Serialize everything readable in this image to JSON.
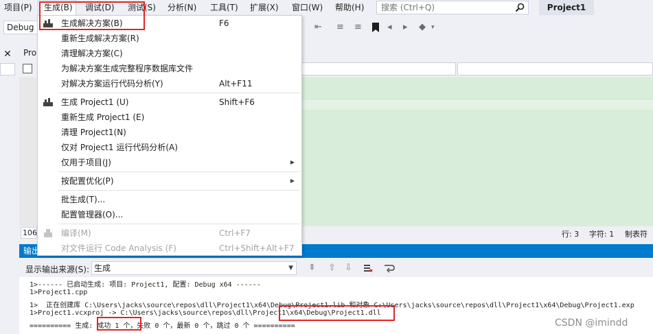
{
  "menubar": {
    "items": [
      "项目(P)",
      "生成(B)",
      "调试(D)",
      "测试(S)",
      "分析(N)",
      "工具(T)",
      "扩展(X)",
      "窗口(W)",
      "帮助(H)"
    ],
    "search_placeholder": "搜索 (Ctrl+Q)",
    "solution_title": "Project1"
  },
  "toolbar": {
    "config": "Debug"
  },
  "editor": {
    "doc_tab": "Pro",
    "nav_left_icon": "class-icon"
  },
  "status": {
    "zoom": "106",
    "line": "行: 3",
    "col": "字符: 1",
    "tabs": "制表符"
  },
  "build_menu": {
    "items": [
      {
        "label": "生成解决方案(B)",
        "shortcut": "F6",
        "icon": "build-solution-icon"
      },
      {
        "label": "重新生成解决方案(R)",
        "shortcut": ""
      },
      {
        "label": "清理解决方案(C)",
        "shortcut": ""
      },
      {
        "label": "为解决方案生成完整程序数据库文件",
        "shortcut": ""
      },
      {
        "label": "对解决方案运行代码分析(Y)",
        "shortcut": "Alt+F11"
      },
      {
        "label": "生成 Project1 (U)",
        "shortcut": "Shift+F6",
        "icon": "build-project-icon"
      },
      {
        "label": "重新生成 Project1 (E)",
        "shortcut": ""
      },
      {
        "label": "清理 Project1(N)",
        "shortcut": ""
      },
      {
        "label": "仅对 Project1 运行代码分析(A)",
        "shortcut": ""
      },
      {
        "label": "仅用于项目(J)",
        "shortcut": "",
        "submenu": true
      },
      {
        "label": "按配置优化(P)",
        "shortcut": "",
        "submenu": true
      },
      {
        "label": "批生成(T)...",
        "shortcut": ""
      },
      {
        "label": "配置管理器(O)...",
        "shortcut": ""
      },
      {
        "label": "编译(M)",
        "shortcut": "Ctrl+F7",
        "disabled": true,
        "icon": "compile-icon"
      },
      {
        "label": "对文件运行 Code Analysis (F)",
        "shortcut": "Ctrl+Shift+Alt+F7",
        "disabled": true
      }
    ]
  },
  "output": {
    "title": "输出",
    "source_label": "显示输出来源(S):",
    "source_value": "生成",
    "lines": [
      "1>------ 已启动生成: 项目: Project1, 配置: Debug x64 ------",
      "1>Project1.cpp",
      "1>  正在创建库 C:\\Users\\jacks\\source\\repos\\dll\\Project1\\x64\\Debug\\Project1.lib 和对象 C:\\Users\\jacks\\source\\repos\\dll\\Project1\\x64\\Debug\\Project1.exp",
      "1>Project1.vcxproj -> C:\\Users\\jacks\\source\\repos\\dll\\Project1\\x64\\Debug\\Project1.dll",
      "========== 生成: 成功 1 个，失败 0 个，最新 0 个，跳过 0 个 =========="
    ]
  },
  "watermark": "CSDN @imindd",
  "colors": {
    "accent": "#007acc",
    "annotation": "#e32222",
    "editor_green": "#d9eeda"
  }
}
